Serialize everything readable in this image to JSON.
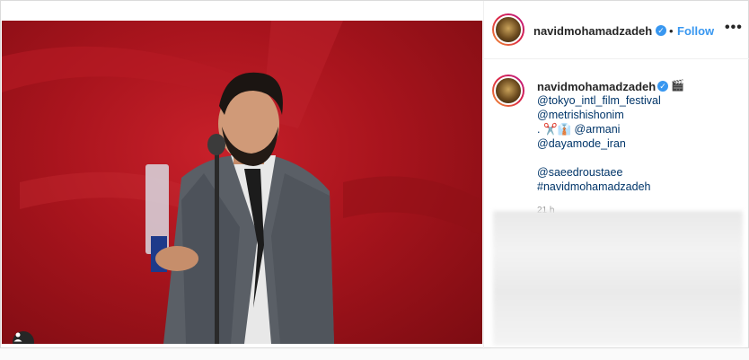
{
  "post": {
    "username": "navidmohamadzadeh",
    "follow_label": "Follow",
    "separator": "•",
    "more_label": "•••",
    "verified_mark": "✓",
    "caption": {
      "username": "navidmohamadzadeh",
      "emoji": "🎬",
      "lines": [
        "@tokyo_intl_film_festival",
        "@metrishishonim",
        ". ✂️👔 @armani",
        "@dayamode_iran",
        "",
        "@saeedroustaee",
        "#navidmohamadzadeh"
      ]
    },
    "timestamp": "21 h"
  },
  "colors": {
    "accent": "#3897f0",
    "link": "#003569",
    "stage_red": "#a8141d"
  },
  "icons": {
    "user_tag": "user-tag-icon",
    "verified": "verified-badge-icon",
    "more": "more-options-icon"
  }
}
